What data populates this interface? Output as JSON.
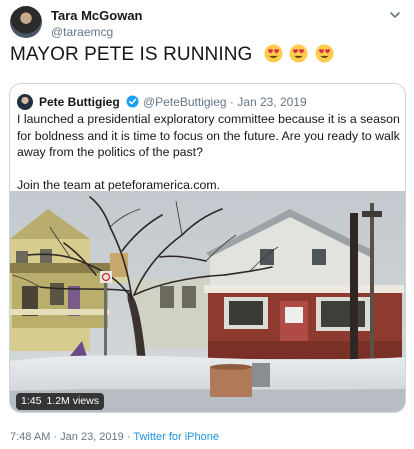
{
  "author": {
    "name": "Tara McGowan",
    "handle": "@taraemcg"
  },
  "tweet": {
    "text": "MAYOR PETE IS RUNNING",
    "emoji_icons": [
      "heart-eyes-emoji",
      "heart-eyes-emoji",
      "heart-eyes-emoji"
    ]
  },
  "quoted": {
    "name": "Pete Buttigieg",
    "handle": "@PeteButtigieg",
    "separator": "·",
    "date": "Jan 23, 2019",
    "body_line1": "I launched a presidential exploratory committee because it is a season for boldness and it is time to focus on the future. Are you ready to walk away from the politics of the past?",
    "body_line2": "Join the team at peteforamerica.com.",
    "video": {
      "duration": "1:45",
      "views": "1.2M views"
    }
  },
  "footer": {
    "time": "7:48 AM",
    "separator1": "·",
    "date": "Jan 23, 2019",
    "separator2": "·",
    "source": "Twitter for iPhone"
  },
  "colors": {
    "text": "#14171a",
    "secondary": "#657786",
    "link": "#1b95e0",
    "border": "#ccd6dd",
    "verified": "#1da1f2"
  },
  "icons": {
    "menu": "chevron-down-icon",
    "verified": "verified-badge-icon"
  }
}
